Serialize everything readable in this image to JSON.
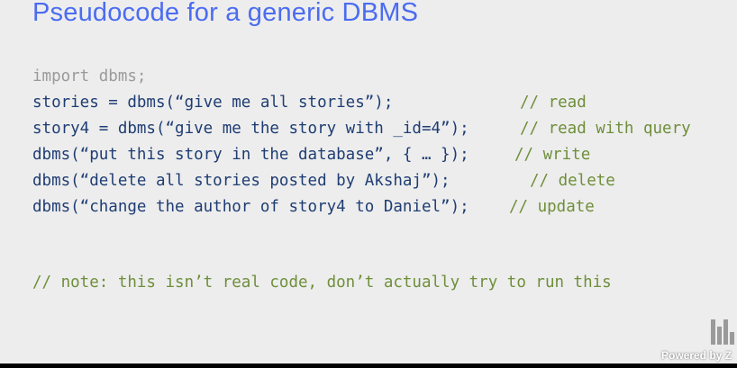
{
  "slide": {
    "title": "Pseudocode for a generic DBMS"
  },
  "code": {
    "import_line": "import dbms;",
    "lines": [
      {
        "code": "stories = dbms(“give me all stories”);",
        "comment": "// read"
      },
      {
        "code": "story4 = dbms(“give me the story with _id=4”);",
        "comment": "// read with query"
      },
      {
        "code": "dbms(“put this story in the database”, { … });",
        "comment": "// write"
      },
      {
        "code": "dbms(“delete all stories posted by Akshaj”);",
        "comment": "// delete"
      },
      {
        "code": "dbms(“change the author of story4 to Daniel”);",
        "comment": "// update"
      }
    ],
    "note": "// note: this isn’t real code, don’t actually try to run this"
  },
  "watermark": {
    "text": "Powered by Z"
  },
  "colors": {
    "title": "#4b6cf0",
    "code": "#1f3d73",
    "comment": "#6f8f3a",
    "import": "#9a9a9a",
    "background": "#ededed"
  }
}
